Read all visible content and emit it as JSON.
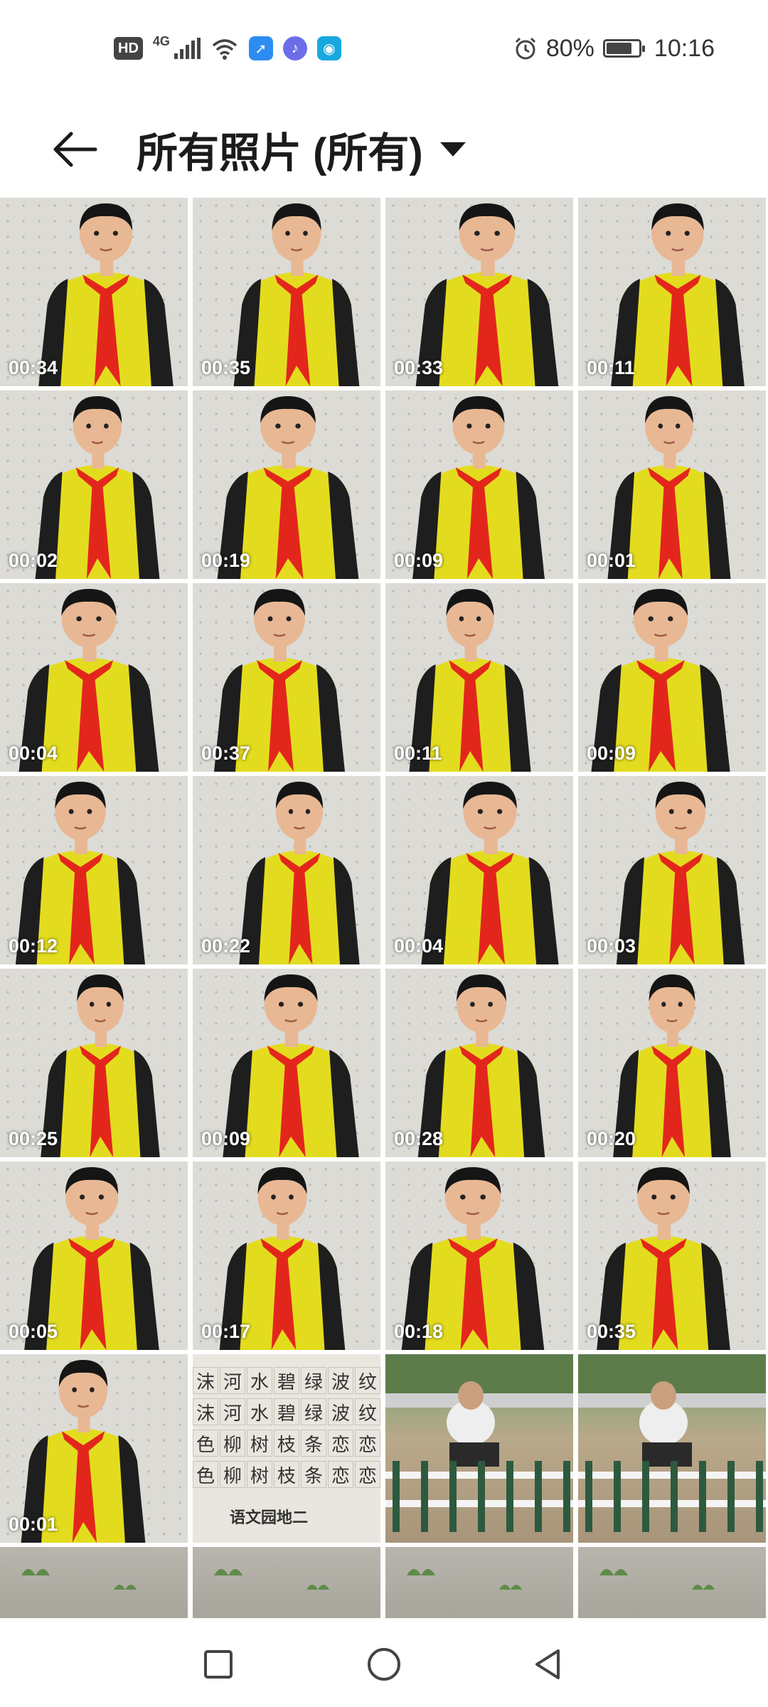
{
  "status_bar": {
    "left_icons": [
      "hd-badge",
      "network-4g",
      "signal-bars",
      "wifi-icon",
      "app-notify-1",
      "music-app-icon",
      "app-notify-2"
    ],
    "hd_label": "HD",
    "network_label": "4G",
    "battery_percent_text": "80%",
    "battery_level": 0.8,
    "time": "10:16"
  },
  "header": {
    "title": "所有照片 (所有)",
    "back_icon": "arrow-left-icon",
    "dropdown_icon": "triangle-down-icon"
  },
  "grid": {
    "columns": 4,
    "items": [
      {
        "duration": "00:34",
        "kind": "video-portrait"
      },
      {
        "duration": "00:35",
        "kind": "video-portrait"
      },
      {
        "duration": "00:33",
        "kind": "video-portrait"
      },
      {
        "duration": "00:11",
        "kind": "video-portrait"
      },
      {
        "duration": "00:02",
        "kind": "video-portrait"
      },
      {
        "duration": "00:19",
        "kind": "video-portrait"
      },
      {
        "duration": "00:09",
        "kind": "video-portrait"
      },
      {
        "duration": "00:01",
        "kind": "video-portrait"
      },
      {
        "duration": "00:04",
        "kind": "video-portrait"
      },
      {
        "duration": "00:37",
        "kind": "video-portrait"
      },
      {
        "duration": "00:11",
        "kind": "video-portrait"
      },
      {
        "duration": "00:09",
        "kind": "video-portrait"
      },
      {
        "duration": "00:12",
        "kind": "video-portrait"
      },
      {
        "duration": "00:22",
        "kind": "video-portrait"
      },
      {
        "duration": "00:04",
        "kind": "video-portrait"
      },
      {
        "duration": "00:03",
        "kind": "video-portrait"
      },
      {
        "duration": "00:25",
        "kind": "video-portrait"
      },
      {
        "duration": "00:09",
        "kind": "video-portrait"
      },
      {
        "duration": "00:28",
        "kind": "video-portrait"
      },
      {
        "duration": "00:20",
        "kind": "video-portrait"
      },
      {
        "duration": "00:05",
        "kind": "video-portrait"
      },
      {
        "duration": "00:17",
        "kind": "video-portrait"
      },
      {
        "duration": "00:18",
        "kind": "video-portrait"
      },
      {
        "duration": "00:35",
        "kind": "video-portrait"
      },
      {
        "duration": "00:01",
        "kind": "video-portrait"
      },
      {
        "duration": "",
        "kind": "photo-notebook"
      },
      {
        "duration": "",
        "kind": "photo-garden"
      },
      {
        "duration": "",
        "kind": "photo-garden"
      },
      {
        "duration": "",
        "kind": "photo-soil"
      },
      {
        "duration": "",
        "kind": "photo-soil"
      },
      {
        "duration": "",
        "kind": "photo-soil"
      },
      {
        "duration": "",
        "kind": "photo-soil"
      }
    ]
  },
  "notebook_rows": [
    [
      "沫",
      "河",
      "水",
      "碧",
      "绿",
      "波",
      "纹"
    ],
    [
      "沫",
      "河",
      "水",
      "碧",
      "绿",
      "波",
      "纹"
    ],
    [
      "色",
      "柳",
      "树",
      "枝",
      "条",
      "恋",
      "恋"
    ],
    [
      "色",
      "柳",
      "树",
      "枝",
      "条",
      "恋",
      "恋"
    ]
  ],
  "notebook_caption": "语文园地二",
  "nav_bar": {
    "buttons": [
      "recents-square-icon",
      "home-circle-icon",
      "back-triangle-icon"
    ]
  },
  "colors": {
    "jacket_yellow": "#e3dc1e",
    "jacket_black": "#1e1e1e",
    "scarf_red": "#e3261c",
    "wall": "#dcdbd6",
    "hair": "#151515",
    "skin": "#e8b894"
  }
}
